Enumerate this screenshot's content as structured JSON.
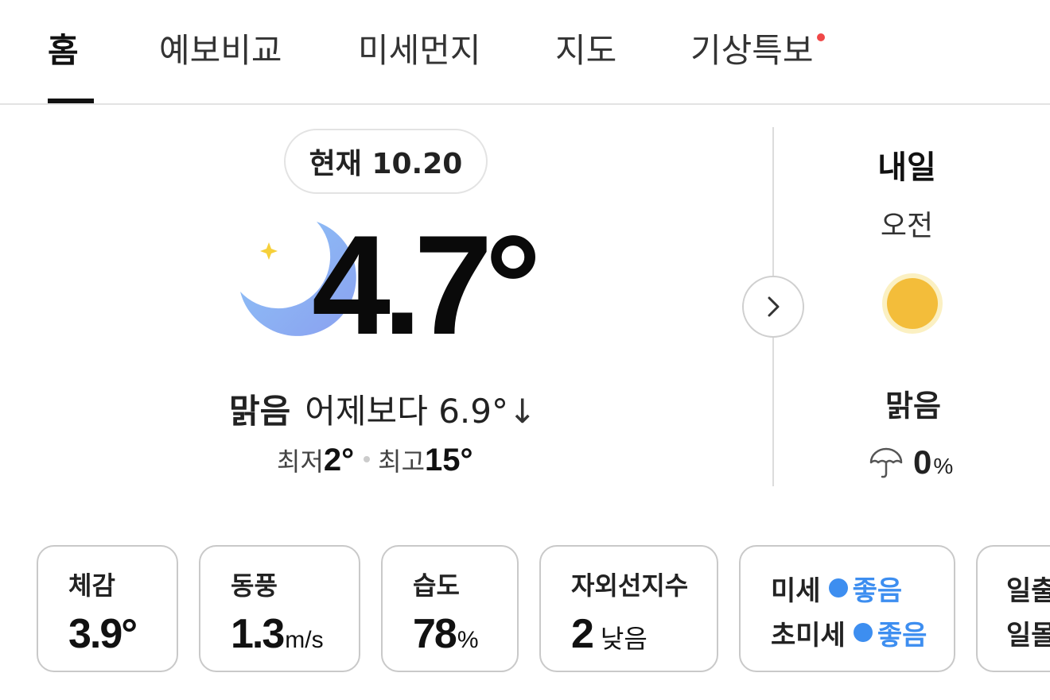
{
  "tabs": [
    {
      "label": "홈",
      "active": true
    },
    {
      "label": "예보비교"
    },
    {
      "label": "미세먼지"
    },
    {
      "label": "지도"
    },
    {
      "label": "기상특보",
      "has_alert_dot": true
    }
  ],
  "current": {
    "badge": "현재 10.20",
    "icon": "moon-star-icon",
    "temperature": "4.7°",
    "condition": "맑음",
    "compare_text": "어제보다 6.9°",
    "compare_arrow": "↓",
    "min_label": "최저",
    "min_value": "2°",
    "max_label": "최고",
    "max_value": "15°"
  },
  "tomorrow": {
    "title": "내일",
    "period": "오전",
    "icon": "sun-icon",
    "condition": "맑음",
    "rain_value": "0",
    "rain_unit": "%"
  },
  "cards": {
    "feels": {
      "label": "체감",
      "value": "3.9°"
    },
    "wind": {
      "label": "동풍",
      "value": "1.3",
      "unit": "m/s"
    },
    "humidity": {
      "label": "습도",
      "value": "78",
      "unit": "%"
    },
    "uv": {
      "label": "자외선지수",
      "value": "2",
      "sub": "낮음"
    },
    "dust": {
      "pm10_label": "미세",
      "pm10_status": "좋음",
      "pm25_label": "초미세",
      "pm25_status": "좋음"
    },
    "sun": {
      "sunrise_label": "일출",
      "sunset_label": "일몰"
    }
  },
  "colors": {
    "accent_blue": "#3d8ef0",
    "alert_red": "#f04848",
    "moon_gradient": [
      "#8ec5f7",
      "#8aa0f0"
    ],
    "sun": "#f3bd3a"
  }
}
